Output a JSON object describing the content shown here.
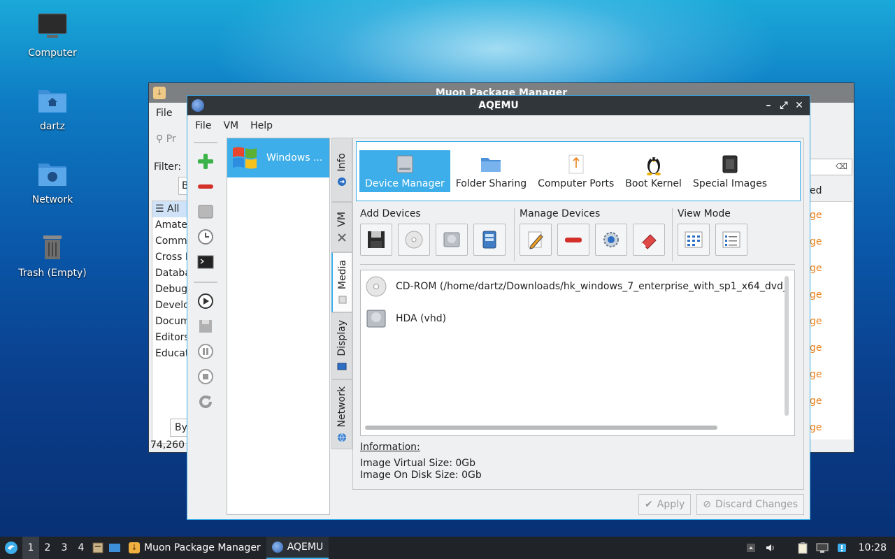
{
  "desktop": {
    "icons": [
      {
        "label": "Computer"
      },
      {
        "label": "dartz"
      },
      {
        "label": "Network"
      },
      {
        "label": "Trash (Empty)"
      }
    ]
  },
  "muon": {
    "title": "Muon Package Manager",
    "menu_file": "File",
    "search_placeholder": "Pr",
    "filter_label": "Filter:",
    "tab_partial": "B",
    "categories": [
      "All",
      "Amateu",
      "Commu",
      "Cross P",
      "Databa",
      "Debug",
      "Develo",
      "Docum",
      "Editors",
      "Educat"
    ],
    "right_header": "ed",
    "right_rows": [
      "ge",
      "ge",
      "ge",
      "ge",
      "ge",
      "ge",
      "ge",
      "ge",
      "ge"
    ],
    "by_tab": "By",
    "status": "74,260 p"
  },
  "aqemu": {
    "title": "AQEMU",
    "menu": {
      "file": "File",
      "vm": "VM",
      "help": "Help"
    },
    "vm_item": "Windows ...",
    "tabs": {
      "info": "Info",
      "vm": "VM",
      "media": "Media",
      "display": "Display",
      "network": "Network"
    },
    "categories": {
      "device_manager": "Device Manager",
      "folder_sharing": "Folder Sharing",
      "computer_ports": "Computer Ports",
      "boot_kernel": "Boot Kernel",
      "special_images": "Special Images"
    },
    "groups": {
      "add_devices": "Add Devices",
      "manage_devices": "Manage Devices",
      "view_mode": "View Mode"
    },
    "devices": [
      {
        "label": "CD-ROM (/home/dartz/Downloads/hk_windows_7_enterprise_with_sp1_x64_dvd_"
      },
      {
        "label": "HDA (vhd)"
      }
    ],
    "info": {
      "heading": "Information:",
      "virtual_size": "Image Virtual Size: 0Gb",
      "disk_size": "Image On Disk Size: 0Gb"
    },
    "buttons": {
      "apply": "Apply",
      "discard": "Discard Changes"
    }
  },
  "taskbar": {
    "workspaces": [
      "1",
      "2",
      "3",
      "4"
    ],
    "tasks": [
      {
        "label": "Muon Package Manager"
      },
      {
        "label": "AQEMU"
      }
    ],
    "clock": "10:28"
  },
  "colors": {
    "accent": "#3daee9",
    "titlebar": "#31363b",
    "window_bg": "#eff0f1",
    "orange_text": "#e8801a"
  }
}
